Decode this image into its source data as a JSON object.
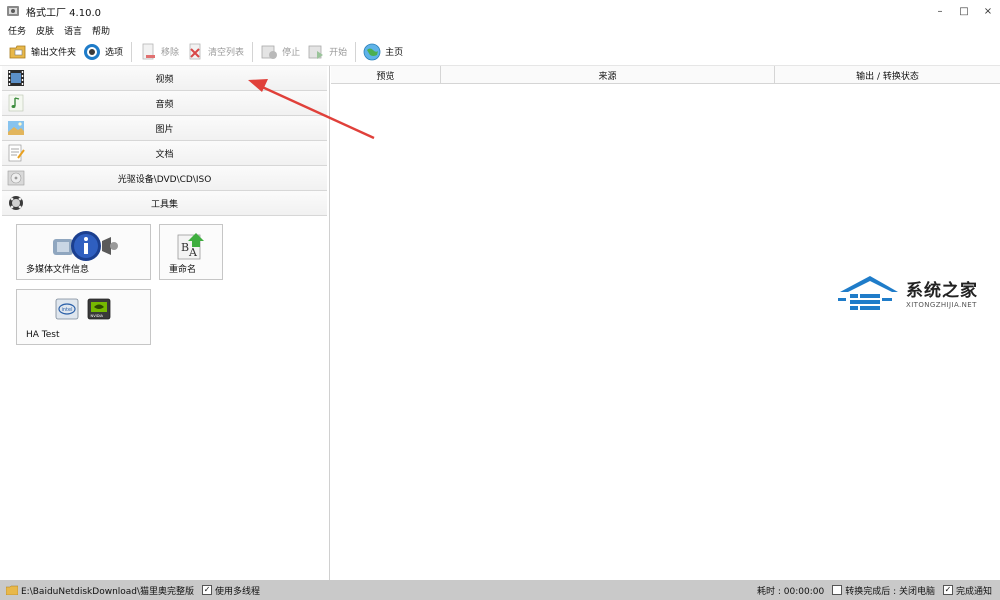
{
  "window": {
    "title": "格式工厂 4.10.0",
    "controls": {
      "minimize": "–",
      "maximize": "□",
      "close": "×"
    }
  },
  "menu": {
    "items": [
      "任务",
      "皮肤",
      "语言",
      "帮助"
    ]
  },
  "toolbar": {
    "output_folder": "输出文件夹",
    "options": "选项",
    "remove": "移除",
    "clear_list": "清空列表",
    "stop": "停止",
    "start": "开始",
    "home": "主页"
  },
  "categories": [
    {
      "label": "视频",
      "icon": "film-icon"
    },
    {
      "label": "音频",
      "icon": "music-note-icon"
    },
    {
      "label": "图片",
      "icon": "picture-icon"
    },
    {
      "label": "文档",
      "icon": "document-icon"
    },
    {
      "label": "光驱设备\\DVD\\CD\\ISO",
      "icon": "disc-icon"
    },
    {
      "label": "工具集",
      "icon": "tools-icon"
    }
  ],
  "tools": {
    "media_info": "多媒体文件信息",
    "rename": "重命名",
    "ha_test": "HA Test",
    "ha_logos": {
      "intel": "intel",
      "nvidia": "NVIDIA"
    }
  },
  "list": {
    "headers": {
      "preview": "预览",
      "source": "来源",
      "status": "输出 / 转换状态"
    }
  },
  "statusbar": {
    "path": "E:\\BaiduNetdiskDownload\\猫里奥完整版",
    "multithread": "使用多线程",
    "multithread_checked": true,
    "elapsed": "耗时 : 00:00:00",
    "after_done": "转换完成后 : 关闭电脑",
    "after_done_checked": false,
    "notify": "完成通知",
    "notify_checked": true
  },
  "watermark": {
    "title": "系统之家",
    "url": "XITONGZHIJIA.NET"
  },
  "colors": {
    "accent_blue": "#1f7cc9",
    "arrow_red": "#e0403a",
    "statusbar": "#c9c9c9"
  }
}
